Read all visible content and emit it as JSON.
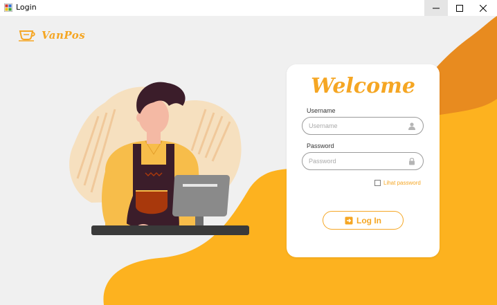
{
  "window": {
    "title": "Login",
    "controls": [
      "minimize",
      "maximize",
      "close"
    ]
  },
  "brand": {
    "name": "VanPos",
    "icon": "coffee-cup-icon"
  },
  "login": {
    "heading": "Welcome",
    "username_label": "Username",
    "username_placeholder": "Username",
    "username_value": "",
    "username_icon": "user-icon",
    "password_label": "Password",
    "password_placeholder": "Password",
    "password_value": "",
    "password_icon": "lock-icon",
    "show_password_label": "Lihat password",
    "show_password_checked": false,
    "login_button_label": "Log In",
    "login_button_icon": "sign-in-icon"
  },
  "colors": {
    "accent": "#f5a623",
    "background_blob_light": "#fdb21f",
    "background_blob_dark": "#e88b1f",
    "panel_bg": "#f0f0f0",
    "card_bg": "#ffffff"
  }
}
